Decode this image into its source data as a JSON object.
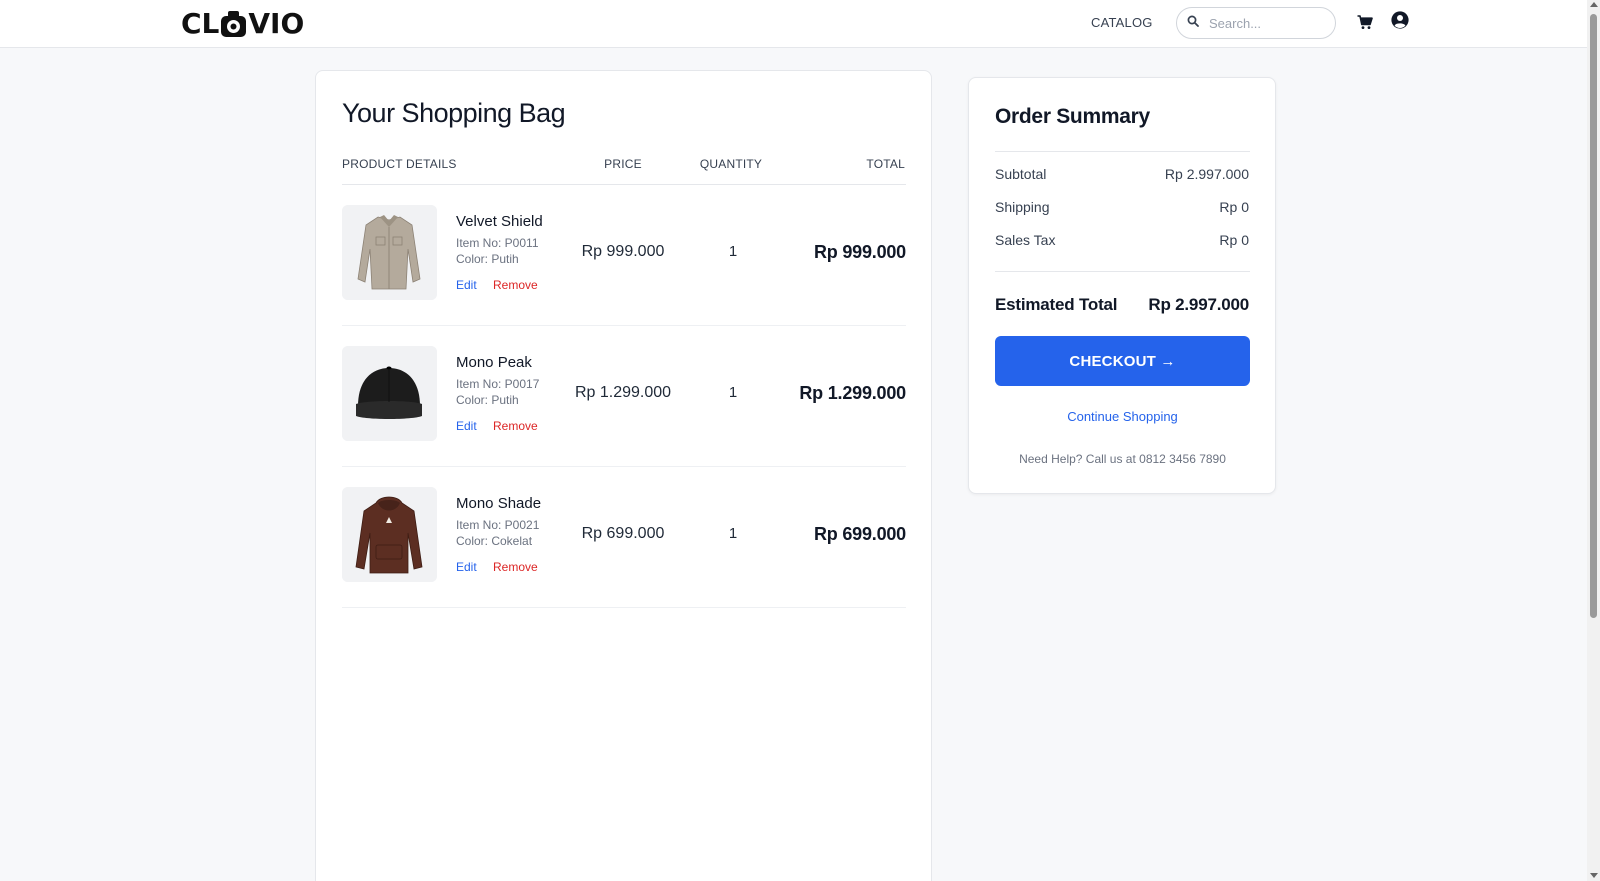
{
  "header": {
    "logo_left": "CL",
    "logo_right": "VIO",
    "nav_catalog": "CATALOG",
    "search_placeholder": "Search...",
    "icons": {
      "search": "search-icon",
      "cart": "cart-icon",
      "user": "user-circle-icon"
    }
  },
  "bag": {
    "title": "Your Shopping Bag",
    "columns": {
      "product": "PRODUCT DETAILS",
      "price": "PRICE",
      "quantity": "QUANTITY",
      "total": "TOTAL"
    },
    "items": [
      {
        "name": "Velvet Shield",
        "item_no": "Item No: P0011",
        "color": "Color: Putih",
        "price": "Rp 999.000",
        "quantity": "1",
        "total": "Rp 999.000",
        "edit": "Edit",
        "remove": "Remove",
        "image": "jacket-image"
      },
      {
        "name": "Mono Peak",
        "item_no": "Item No: P0017",
        "color": "Color: Putih",
        "price": "Rp 1.299.000",
        "quantity": "1",
        "total": "Rp 1.299.000",
        "edit": "Edit",
        "remove": "Remove",
        "image": "cap-image"
      },
      {
        "name": "Mono Shade",
        "item_no": "Item No: P0021",
        "color": "Color: Cokelat",
        "price": "Rp 699.000",
        "quantity": "1",
        "total": "Rp 699.000",
        "edit": "Edit",
        "remove": "Remove",
        "image": "hoodie-image"
      }
    ]
  },
  "summary": {
    "title": "Order Summary",
    "subtotal_label": "Subtotal",
    "subtotal_value": "Rp 2.997.000",
    "shipping_label": "Shipping",
    "shipping_value": "Rp 0",
    "tax_label": "Sales Tax",
    "tax_value": "Rp 0",
    "estimated_label": "Estimated Total",
    "estimated_value": "Rp 2.997.000",
    "checkout_label": "CHECKOUT →",
    "continue_label": "Continue Shopping",
    "help_text": "Need Help? Call us at 0812 3456 7890"
  },
  "colors": {
    "primary": "#2563eb",
    "danger": "#dc2626",
    "text": "#111827",
    "background": "#f7f8fa"
  }
}
